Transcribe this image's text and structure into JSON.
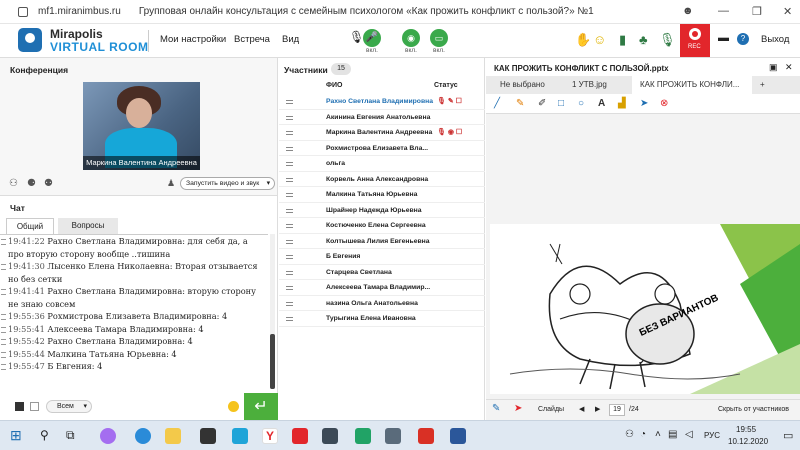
{
  "browser": {
    "url": "mf1.miranimbus.ru",
    "title": "Групповая онлайн консультация с семейным психологом «Как прожить конфликт с пользой?» №1"
  },
  "header": {
    "logo_line1": "Mirapolis",
    "logo_line2": "VIRTUAL ROOM",
    "nav": [
      "Мои настройки",
      "Встреча",
      "Вид"
    ],
    "mic_label": "вкл.",
    "cam_label": "вкл.",
    "screen_label": "вкл.",
    "rec_label": "REC",
    "exit_label": "Выход"
  },
  "conference": {
    "title": "Конференция",
    "video_caption": "Маркина Валентина  Андреевна",
    "video_button": "Запустить видео и звук"
  },
  "chat": {
    "title": "Чат",
    "tabs": [
      "Общий",
      "Вопросы"
    ],
    "messages": [
      {
        "time": "19:41:22",
        "text": "Рахно Светлана  Владимировна: для себя да, а про вторую сторону вообще ..тишина"
      },
      {
        "time": "19:41:30",
        "text": "Лысенко  Елена  Николаевна: Вторая отзывается но без сетки"
      },
      {
        "time": "19:41:41",
        "text": "Рахно Светлана  Владимировна: вторую сторону не знаю совсем"
      },
      {
        "time": "19:55:36",
        "text": "Рохмистрова  Елизавета Владимировна: 4"
      },
      {
        "time": "19:55:41",
        "text": "Алексеева Тамара  Владимировна: 4"
      },
      {
        "time": "19:55:42",
        "text": "Рахно Светлана  Владимировна: 4"
      },
      {
        "time": "19:55:44",
        "text": "Малкина Татьяна  Юрьевна: 4"
      },
      {
        "time": "19:55:47",
        "text": "Б  Евгения: 4"
      }
    ],
    "audience": "Всем",
    "send": "↵"
  },
  "participants": {
    "title": "Участники",
    "count": "15",
    "col_name": "ФИО",
    "col_status": "Статус",
    "rows": [
      {
        "name": "Рахно Светлана  Владимировна",
        "status": "🎙 ✎ ☐"
      },
      {
        "name": "Акинина  Евгения  Анатольевна",
        "status": ""
      },
      {
        "name": "Маркина Валентина  Андреевна",
        "status": "🎙 ◉ ☐"
      },
      {
        "name": "Рохмистрова  Елизавета Вла...",
        "status": ""
      },
      {
        "name": "ольга",
        "status": ""
      },
      {
        "name": "Корвель Анна  Александровна",
        "status": ""
      },
      {
        "name": "Малкина Татьяна  Юрьевна",
        "status": ""
      },
      {
        "name": "Шрайнер Надежда  Юрьевна",
        "status": ""
      },
      {
        "name": "Костюченко  Елена Сергеевна",
        "status": ""
      },
      {
        "name": "Колтышева  Лилия Евгеньевна",
        "status": ""
      },
      {
        "name": "Б  Евгения",
        "status": ""
      },
      {
        "name": "Старцева  Светлана",
        "status": ""
      },
      {
        "name": "Алексеева Тамара  Владимир...",
        "status": ""
      },
      {
        "name": "назина  Ольга Анатольевна",
        "status": ""
      },
      {
        "name": "Турыгина  Елена  Ивановна",
        "status": ""
      }
    ]
  },
  "presentation": {
    "title": "КАК ПРОЖИТЬ КОНФЛИКТ С ПОЛЬЗОЙ.pptx",
    "tabs": [
      "Не выбрано",
      "1 УТВ.jpg",
      "КАК ПРОЖИТЬ КОНФЛИ...",
      "+"
    ],
    "slide_text": "БЕЗ ВАРИАНТОВ",
    "slides_label": "Слайды",
    "page": "19",
    "total": "/24",
    "hide_label": "Скрыть от участников"
  },
  "taskbar": {
    "lang": "РУС",
    "time": "19:55",
    "date": "10.12.2020"
  },
  "colors": {
    "accent": "#1f8fd6",
    "green": "#4caf3c",
    "rec": "#e2262b"
  }
}
